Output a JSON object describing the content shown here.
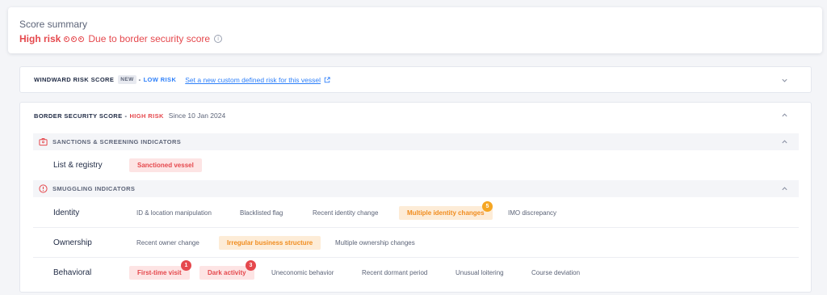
{
  "summary": {
    "title": "Score summary",
    "risk_level": "High risk",
    "reason": "Due to border security score",
    "info_glyph": "i"
  },
  "windward": {
    "title": "WINDWARD RISK SCORE",
    "new_badge": "NEW",
    "separator": "-",
    "risk": "LOW RISK",
    "link": "Set a new custom defined risk for this vessel"
  },
  "border": {
    "title": "BORDER SECURITY SCORE",
    "separator": "-",
    "risk": "HIGH RISK",
    "since": "Since 10 Jan 2024"
  },
  "sanctions": {
    "title": "SANCTIONS & SCREENING INDICATORS",
    "rows": [
      {
        "label": "List & registry",
        "chips": [
          "Sanctioned vessel"
        ]
      }
    ]
  },
  "smuggling": {
    "title": "SMUGGLING INDICATORS",
    "rows": [
      {
        "label": "Identity",
        "chips": [
          "ID & location manipulation",
          "Blacklisted flag",
          "Recent identity change",
          "Multiple identity changes",
          "IMO discrepancy"
        ],
        "counts": [
          "5"
        ]
      },
      {
        "label": "Ownership",
        "chips": [
          "Recent owner change",
          "Irregular business structure",
          "Multiple ownership changes"
        ]
      },
      {
        "label": "Behavioral",
        "chips": [
          "First-time visit",
          "Dark activity",
          "Uneconomic behavior",
          "Recent dormant period",
          "Unusual loitering",
          "Course deviation"
        ],
        "counts": [
          "1",
          "3"
        ]
      }
    ]
  },
  "colors": {
    "high": "#e5484d",
    "low": "#2d7ff9",
    "warning": "#f5a623",
    "muted": "#5c6478"
  },
  "icons": [
    "info-icon",
    "external-link-icon",
    "chevron-down-icon",
    "chevron-up-icon",
    "id-card-icon",
    "alert-circle-icon"
  ]
}
